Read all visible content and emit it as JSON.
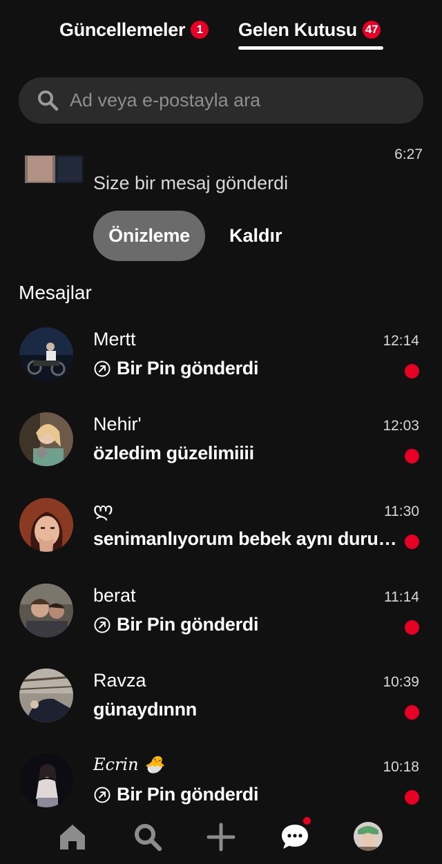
{
  "tabs": {
    "updates": {
      "label": "Güncellemeler",
      "badge": "1"
    },
    "inbox": {
      "label": "Gelen Kutusu",
      "badge": "47"
    }
  },
  "search": {
    "placeholder": "Ad veya e-postayla ara"
  },
  "request": {
    "time": "6:27",
    "text": "Size bir mesaj gönderdi",
    "preview_label": "Önizleme",
    "remove_label": "Kaldır"
  },
  "messages_title": "Mesajlar",
  "conversations": [
    {
      "name": "Mertt",
      "time": "12:14",
      "preview": "Bir Pin gönderdi",
      "is_pin": true,
      "unread": true
    },
    {
      "name": "Nehir'",
      "time": "12:03",
      "preview": "özledim güzelimiiii",
      "is_pin": false,
      "unread": true
    },
    {
      "name": "ლ",
      "time": "11:30",
      "preview": "senimanlıyorum bebek aynı durumdayız",
      "is_pin": false,
      "unread": true
    },
    {
      "name": "berat",
      "time": "11:14",
      "preview": "Bir Pin gönderdi",
      "is_pin": true,
      "unread": true
    },
    {
      "name": "Ravza",
      "time": "10:39",
      "preview": "günaydınnn",
      "is_pin": false,
      "unread": true
    },
    {
      "name": "Ecrin 🐣",
      "time": "10:18",
      "preview": "Bir Pin gönderdi",
      "is_pin": true,
      "unread": true
    }
  ],
  "nav": {
    "items": [
      "home-icon",
      "search-icon",
      "plus-icon",
      "messages-icon",
      "profile-avatar"
    ]
  },
  "colors": {
    "background": "#111111",
    "accent": "#e60023",
    "search_bg": "#2b2b2b",
    "secondary_button": "#6b6b6b"
  }
}
